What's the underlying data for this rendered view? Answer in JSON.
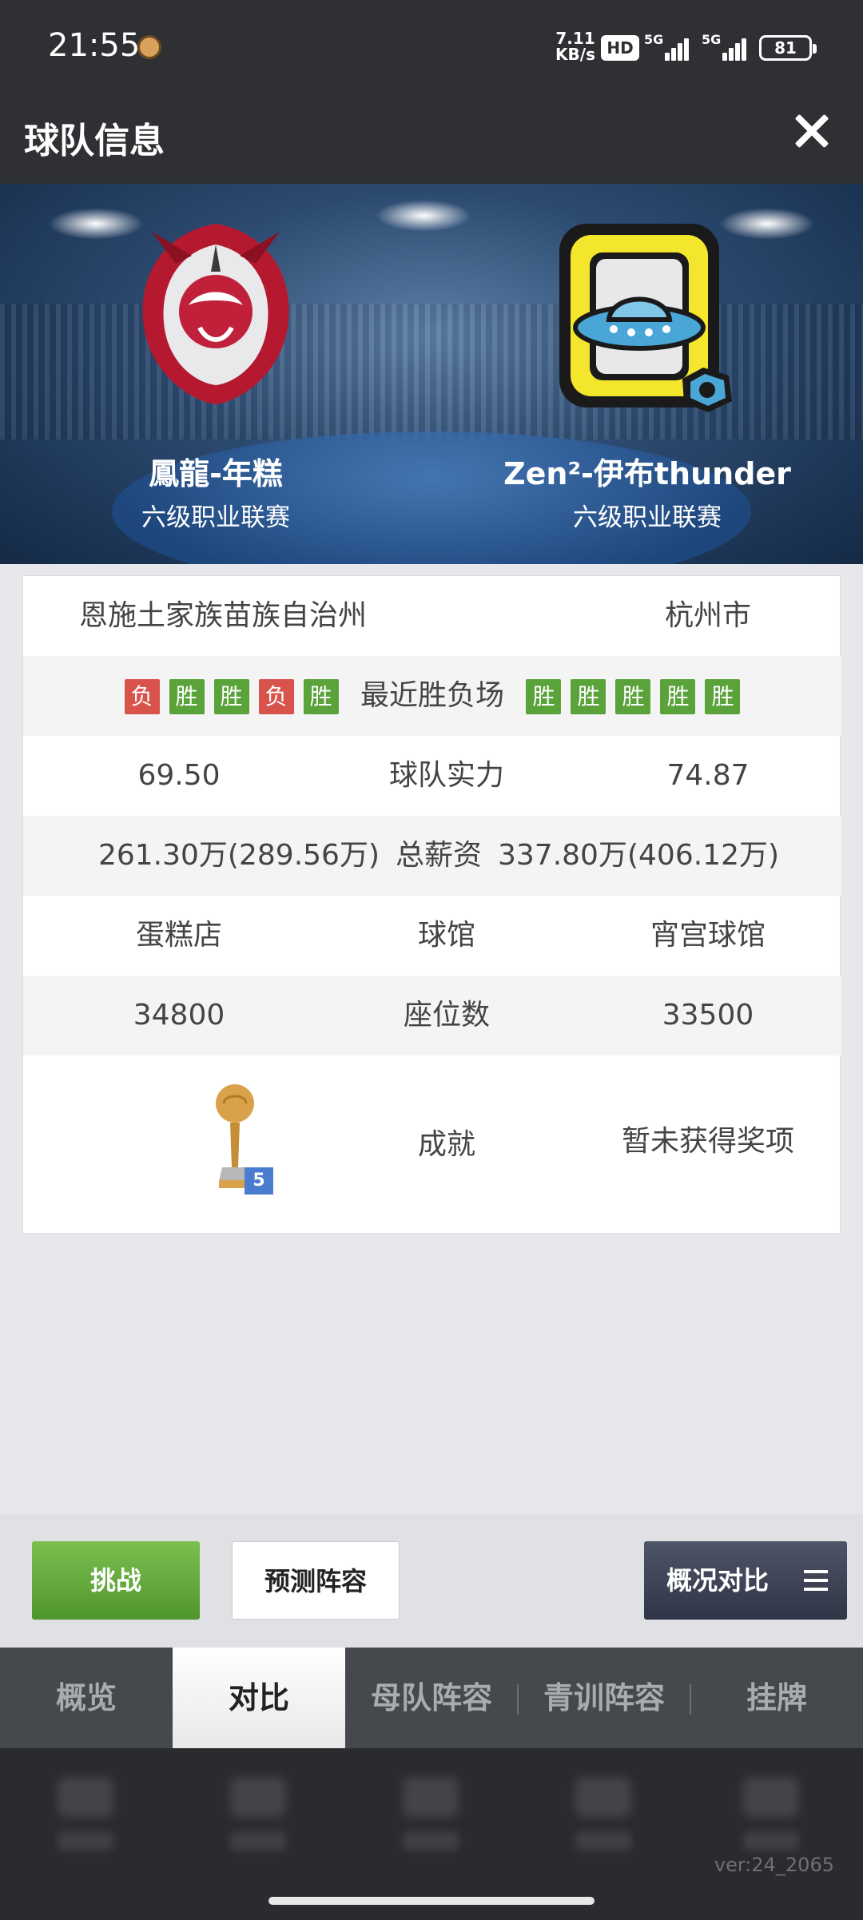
{
  "status_bar": {
    "time": "21:55",
    "net_rate": "7.11 KB/s",
    "hd": "HD",
    "sim1": "5G",
    "sim2": "5G",
    "battery": "81"
  },
  "header": {
    "title": "球队信息"
  },
  "teams": {
    "left": {
      "name": "鳳龍-年糕",
      "league": "六级职业联赛"
    },
    "right": {
      "name": "Zen²-伊布thunder",
      "league": "六级职业联赛"
    }
  },
  "comparison": {
    "location": {
      "left": "恩施土家族苗族自治州",
      "right": "杭州市"
    },
    "recent": {
      "label": "最近胜负场",
      "left": [
        "负",
        "胜",
        "胜",
        "负",
        "胜"
      ],
      "right": [
        "胜",
        "胜",
        "胜",
        "胜",
        "胜"
      ]
    },
    "strength": {
      "label": "球队实力",
      "left": "69.50",
      "right": "74.87"
    },
    "salary": {
      "label": "总薪资",
      "left": "261.30万(289.56万)",
      "right": "337.80万(406.12万)"
    },
    "arena": {
      "label": "球馆",
      "left": "蛋糕店",
      "right": "宵宫球馆"
    },
    "seats": {
      "label": "座位数",
      "left": "34800",
      "right": "33500"
    },
    "achievements": {
      "label": "成就",
      "left_trophy_count": "5",
      "right": "暂未获得奖项"
    }
  },
  "actions": {
    "challenge": "挑战",
    "predict": "预测阵容",
    "compare": "概况对比"
  },
  "tabs": [
    "概览",
    "对比",
    "母队阵容",
    "青训阵容",
    "挂牌"
  ],
  "active_tab": "对比",
  "version": "ver:24_2065",
  "colors": {
    "win": "#5aa23a",
    "loss": "#d8534c",
    "header": "#2f3033",
    "accent": "#4f962c"
  }
}
